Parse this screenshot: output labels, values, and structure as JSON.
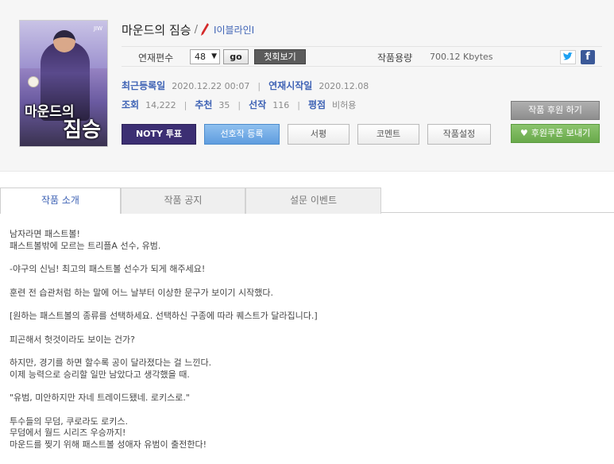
{
  "work": {
    "title": "마운드의 짐승",
    "slash": "/",
    "author": "I이블라인I",
    "cover": {
      "logo": "JIW",
      "art_line1": "마운드의",
      "art_line2": "짐승"
    }
  },
  "episodes": {
    "label": "연재편수",
    "selected": "48",
    "go_label": "go",
    "first_label": "첫회보기"
  },
  "volume": {
    "label": "작품용량",
    "value": "700.12 Kbytes"
  },
  "share": {
    "twitter_icon": "twitter-icon",
    "facebook_icon": "facebook-icon",
    "facebook_glyph": "f",
    "twitter_color": "#1da1f2",
    "facebook_color": "#3b5998"
  },
  "stats": {
    "last_registered_label": "최근등록일",
    "last_registered": "2020.12.22 00:07",
    "serial_start_label": "연재시작일",
    "serial_start": "2020.12.08",
    "views_label": "조회",
    "views": "14,222",
    "recommend_label": "추천",
    "recommend": "35",
    "preferred_label": "선작",
    "preferred": "116",
    "rating_label": "평점",
    "rating": "비허용"
  },
  "actions": {
    "noty": "NOTY 투표",
    "favorite_author": "선호작 등록",
    "review": "서평",
    "comment": "코멘트",
    "settings": "작품설정",
    "support": "작품 후원 하기",
    "coupon": "후원쿠폰 보내기"
  },
  "tabs": [
    {
      "label": "작품 소개",
      "active": true
    },
    {
      "label": "작품 공지",
      "active": false
    },
    {
      "label": "설문 이벤트",
      "active": false
    }
  ],
  "intro": {
    "p1_l1": "남자라면 패스트볼!",
    "p1_l2": "패스트볼밖에 모르는 트리플A 선수, 유범.",
    "p2": "-야구의 신님! 최고의 패스트볼 선수가 되게 해주세요!",
    "p3": "훈련 전 습관처럼 하는 말에 어느 날부터 이상한 문구가 보이기 시작했다.",
    "p4": "[원하는 패스트볼의 종류를 선택하세요. 선택하신 구종에 따라 퀘스트가 달라집니다.]",
    "p5": "피곤해서 헛것이라도 보이는 건가?",
    "p6_l1": "하지만, 경기를 하면 할수록 공이 달라졌다는 걸 느낀다.",
    "p6_l2": "이제 능력으로 승리할 일만 남았다고 생각했을 때.",
    "p7": "\"유범, 미안하지만 자네 트레이드됐네. 로키스로.\"",
    "p8_l1": "투수들의 무덤, 쿠로라도 로키스.",
    "p8_l2": "무덤에서 월드 시리즈 우승까지!",
    "p8_l3": "마운드를 찢기 위해 패스트볼 성애자 유범이 출전한다!"
  }
}
